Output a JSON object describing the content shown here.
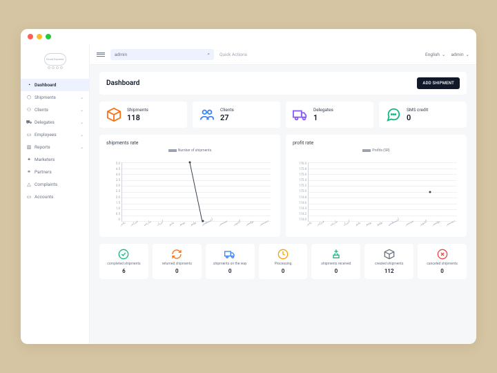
{
  "logo_text": "Cloud Express",
  "nav": {
    "dashboard": "Dashboard",
    "shipments": "Shipments",
    "clients": "Clients",
    "delegates": "Delegates",
    "employees": "Employees",
    "reports": "Reports",
    "marketers": "Marketers",
    "partners": "Partners",
    "complaints": "Complaints",
    "accounts": "Accounts"
  },
  "topbar": {
    "search_value": "admin",
    "quick_actions": "Quick Actions",
    "language": "English",
    "user": "admin"
  },
  "page_title": "Dashboard",
  "add_button": "ADD SHIPMENT",
  "cards": {
    "shipments": {
      "label": "Shipments",
      "value": "118"
    },
    "clients": {
      "label": "Clients",
      "value": "27"
    },
    "delegates": {
      "label": "Delegates",
      "value": "1"
    },
    "sms": {
      "label": "SMS credit",
      "value": "0"
    }
  },
  "chart_data": [
    {
      "type": "line",
      "title": "shipments rate",
      "legend": "Number of shipments",
      "ylabel": "",
      "ylim": [
        0,
        5.0
      ],
      "yticks": [
        "5.0",
        "4.5",
        "4.0",
        "3.5",
        "3.0",
        "2.5",
        "2.0",
        "1.5",
        "1.0",
        "0.5",
        "0"
      ],
      "categories": [
        "يناير",
        "فبراير",
        "مارس",
        "أبريل",
        "مايو",
        "يونيو",
        "يوليو",
        "أغسطس",
        "سبتمبر",
        "أكتوبر",
        "نوفمبر",
        "ديسمبر"
      ],
      "values": [
        null,
        null,
        null,
        null,
        null,
        5.0,
        0,
        null,
        null,
        null,
        null,
        null
      ]
    },
    {
      "type": "line",
      "title": "profit rate",
      "legend": "Profits (SR)",
      "ylabel": "",
      "ylim": [
        174.0,
        176.0
      ],
      "yticks": [
        "176.0",
        "175.8",
        "175.6",
        "175.4",
        "175.2",
        "175.0",
        "174.8",
        "174.6",
        "174.4",
        "174.2",
        "174.0"
      ],
      "categories": [
        "يناير",
        "فبراير",
        "مارس",
        "أبريل",
        "مايو",
        "يونيو",
        "يوليو",
        "أغسطس",
        "سبتمبر",
        "أكتوبر",
        "نوفمبر",
        "ديسمبر"
      ],
      "values": [
        null,
        null,
        null,
        null,
        null,
        null,
        null,
        null,
        null,
        175.0,
        null,
        null
      ]
    }
  ],
  "stats": [
    {
      "label": "completed shipments",
      "value": "6"
    },
    {
      "label": "returned shipments",
      "value": "0"
    },
    {
      "label": "shipments on the way",
      "value": "0"
    },
    {
      "label": "Processing",
      "value": "0"
    },
    {
      "label": "shipments received",
      "value": "0"
    },
    {
      "label": "created shipments",
      "value": "112"
    },
    {
      "label": "canceled shipments",
      "value": "0"
    }
  ]
}
